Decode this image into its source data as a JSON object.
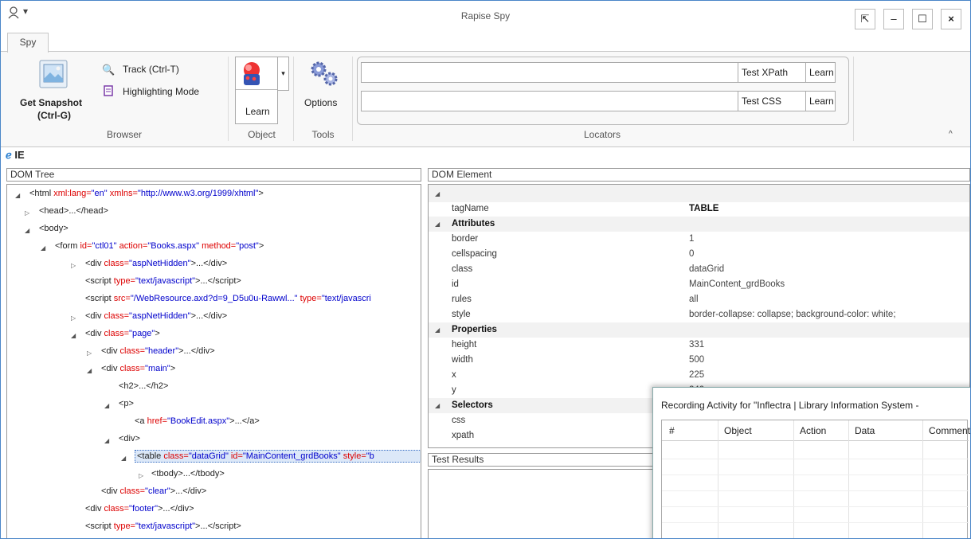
{
  "window": {
    "title": "Rapise Spy"
  },
  "tabs": [
    {
      "label": "Spy"
    }
  ],
  "ribbon": {
    "browser": {
      "get_snapshot": "Get Snapshot",
      "get_snapshot_shortcut": "(Ctrl-G)",
      "track": "Track (Ctrl-T)",
      "highlighting": "Highlighting Mode",
      "group": "Browser"
    },
    "object": {
      "learn": "Learn",
      "group": "Object"
    },
    "tools": {
      "options": "Options",
      "group": "Tools"
    },
    "locators": {
      "test_xpath": "Test XPath",
      "test_css": "Test CSS",
      "learn1": "Learn",
      "learn2": "Learn",
      "group": "Locators",
      "xpath_value": "",
      "css_value": ""
    }
  },
  "browser_label": "IE",
  "dom_tree": {
    "header": "DOM Tree"
  },
  "dom_element": {
    "header": "DOM Element",
    "tagName_key": "tagName",
    "tagName_value": "TABLE",
    "attributes_label": "Attributes",
    "attributes": [
      {
        "k": "border",
        "v": "1"
      },
      {
        "k": "cellspacing",
        "v": "0"
      },
      {
        "k": "class",
        "v": "dataGrid"
      },
      {
        "k": "id",
        "v": "MainContent_grdBooks"
      },
      {
        "k": "rules",
        "v": "all"
      },
      {
        "k": "style",
        "v": "border-collapse: collapse; background-color: white;"
      }
    ],
    "properties_label": "Properties",
    "properties": [
      {
        "k": "height",
        "v": "331"
      },
      {
        "k": "width",
        "v": "500"
      },
      {
        "k": "x",
        "v": "225"
      },
      {
        "k": "y",
        "v": "240"
      }
    ],
    "selectors_label": "Selectors",
    "selectors": [
      {
        "k": "css",
        "v": ""
      },
      {
        "k": "xpath",
        "v": ""
      }
    ]
  },
  "test_results": {
    "header": "Test Results"
  },
  "recording": {
    "title": "Recording Activity for \"Inflectra | Library Information System -",
    "columns": [
      "#",
      "Object",
      "Action",
      "Data",
      "Comment"
    ]
  }
}
